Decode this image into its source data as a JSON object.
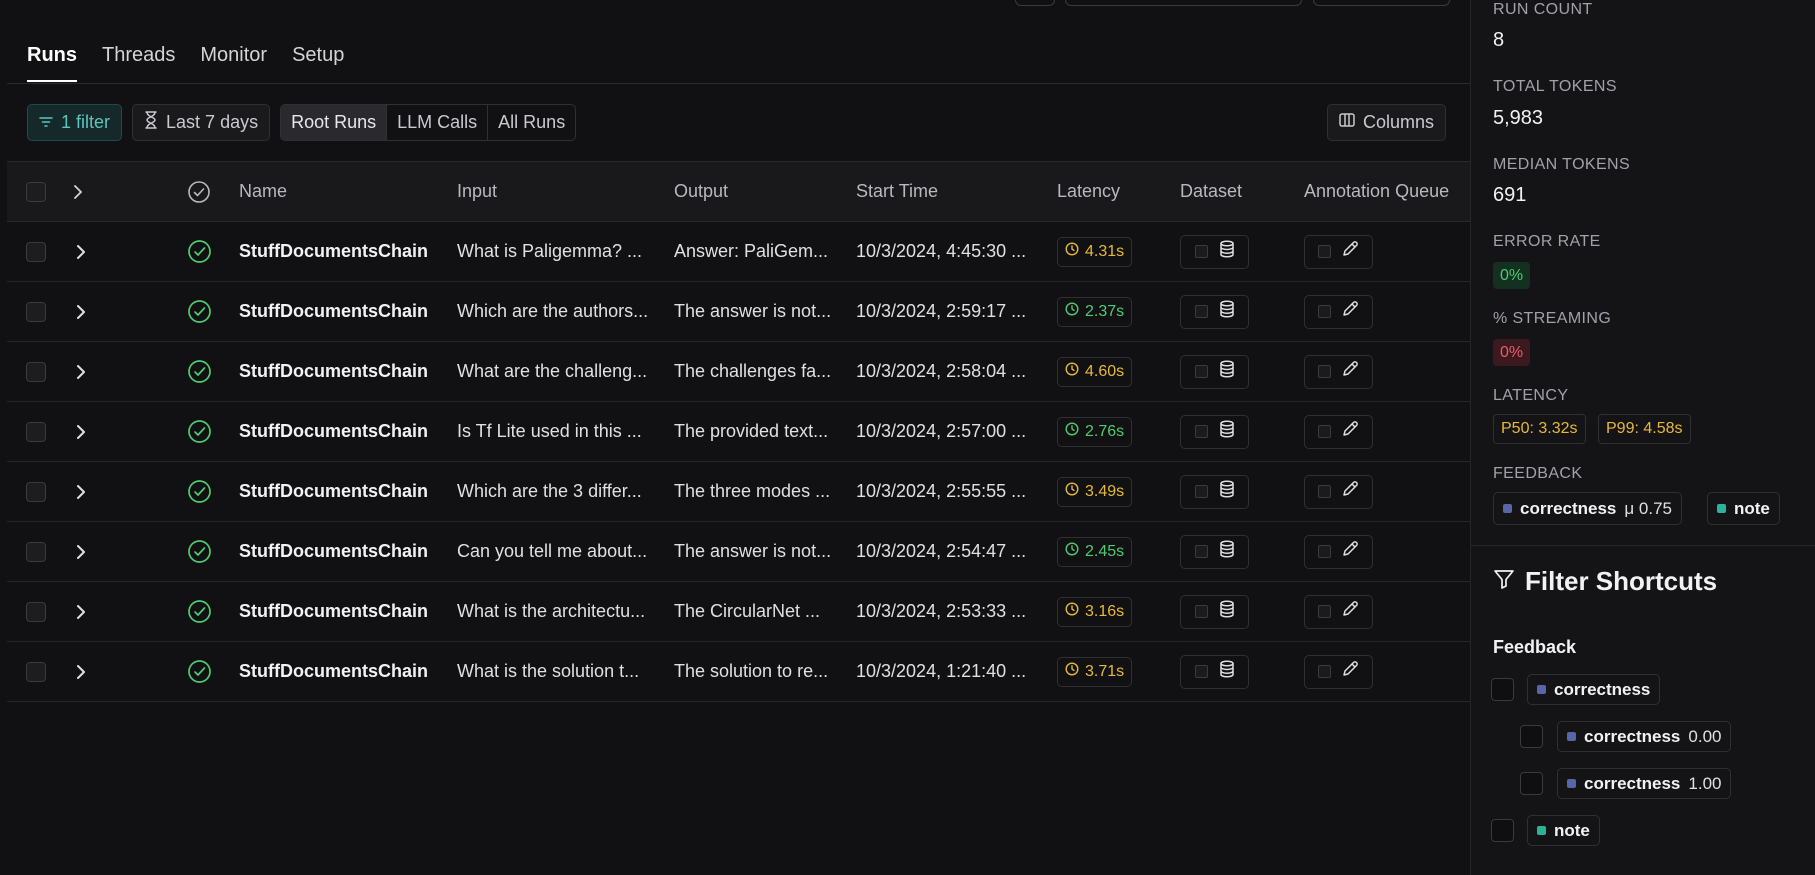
{
  "tabs": [
    {
      "label": "Runs",
      "active": true
    },
    {
      "label": "Threads",
      "active": false
    },
    {
      "label": "Monitor",
      "active": false
    },
    {
      "label": "Setup",
      "active": false
    }
  ],
  "toolbar": {
    "filter_label": "1 filter",
    "time_label": "Last 7 days",
    "segments": [
      "Root Runs",
      "LLM Calls",
      "All Runs"
    ],
    "active_segment": "Root Runs",
    "columns_label": "Columns"
  },
  "table": {
    "headers": {
      "name": "Name",
      "input": "Input",
      "output": "Output",
      "start_time": "Start Time",
      "latency": "Latency",
      "dataset": "Dataset",
      "annotation_queue": "Annotation Queue"
    },
    "rows": [
      {
        "name": "StuffDocumentsChain",
        "input": "What is Paligemma? ...",
        "output": "Answer: PaliGem...",
        "start": "10/3/2024, 4:45:30 ...",
        "latency": "4.31s",
        "lat_color": "yellow"
      },
      {
        "name": "StuffDocumentsChain",
        "input": "Which are the authors...",
        "output": "The answer is not...",
        "start": "10/3/2024, 2:59:17 ...",
        "latency": "2.37s",
        "lat_color": "green"
      },
      {
        "name": "StuffDocumentsChain",
        "input": "What are the challeng...",
        "output": "The challenges fa...",
        "start": "10/3/2024, 2:58:04 ...",
        "latency": "4.60s",
        "lat_color": "yellow"
      },
      {
        "name": "StuffDocumentsChain",
        "input": "Is Tf Lite used in this ...",
        "output": "The provided text...",
        "start": "10/3/2024, 2:57:00 ...",
        "latency": "2.76s",
        "lat_color": "green"
      },
      {
        "name": "StuffDocumentsChain",
        "input": "Which are the 3 differ...",
        "output": "The three modes ...",
        "start": "10/3/2024, 2:55:55 ...",
        "latency": "3.49s",
        "lat_color": "yellow"
      },
      {
        "name": "StuffDocumentsChain",
        "input": "Can you tell me about...",
        "output": "The answer is not...",
        "start": "10/3/2024, 2:54:47 ...",
        "latency": "2.45s",
        "lat_color": "green"
      },
      {
        "name": "StuffDocumentsChain",
        "input": "What is the architectu...",
        "output": "The CircularNet ...",
        "start": "10/3/2024, 2:53:33 ...",
        "latency": "3.16s",
        "lat_color": "yellow"
      },
      {
        "name": "StuffDocumentsChain",
        "input": "What is the solution t...",
        "output": "The solution to re...",
        "start": "10/3/2024, 1:21:40 ...",
        "latency": "3.71s",
        "lat_color": "yellow"
      }
    ]
  },
  "stats": {
    "run_count_label": "RUN COUNT",
    "run_count": "8",
    "total_tokens_label": "TOTAL TOKENS",
    "total_tokens": "5,983",
    "median_tokens_label": "MEDIAN TOKENS",
    "median_tokens": "691",
    "error_rate_label": "ERROR RATE",
    "error_rate": "0%",
    "streaming_label": "% STREAMING",
    "streaming": "0%",
    "latency_label": "LATENCY",
    "p50": "P50: 3.32s",
    "p99": "P99: 4.58s",
    "feedback_label": "FEEDBACK",
    "fb_correctness": "correctness",
    "fb_mu": "μ 0.75",
    "fb_note": "note"
  },
  "filter_shortcuts": {
    "title": "Filter Shortcuts",
    "feedback_label": "Feedback",
    "items": [
      {
        "label": "correctness",
        "value": ""
      },
      {
        "label": "correctness",
        "value": "0.00"
      },
      {
        "label": "correctness",
        "value": "1.00"
      },
      {
        "label": "note",
        "value": ""
      }
    ]
  },
  "colors": {
    "accent_teal": "#5fc3c0",
    "success": "#4ecb71",
    "warning": "#e8b83a",
    "error": "#ef5a6a"
  }
}
